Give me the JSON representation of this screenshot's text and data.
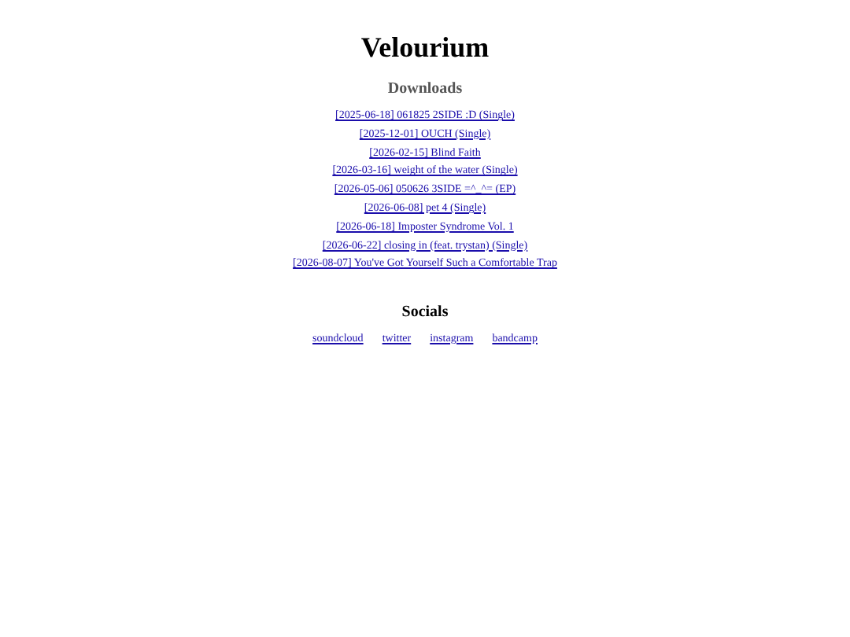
{
  "title": "Velourium",
  "downloads": {
    "heading": "Downloads",
    "links": [
      "[2025-06-18] 061825 2SIDE :D (Single)",
      "[2025-12-01] OUCH (Single)",
      "[2026-02-15] Blind Faith",
      "[2026-03-16] weight of the water (Single)",
      "[2026-05-06] 050626 3SIDE =^_^= (EP)",
      "[2026-06-08] pet 4 (Single)",
      "[2026-06-18] Imposter Syndrome Vol. 1",
      "[2026-06-22] closing in (feat. trystan) (Single)",
      "[2026-08-07] You've Got Yourself Such a Comfortable Trap"
    ]
  },
  "socials": {
    "heading": "Socials",
    "links": [
      "soundcloud",
      "twitter",
      "instagram",
      "bandcamp"
    ]
  }
}
